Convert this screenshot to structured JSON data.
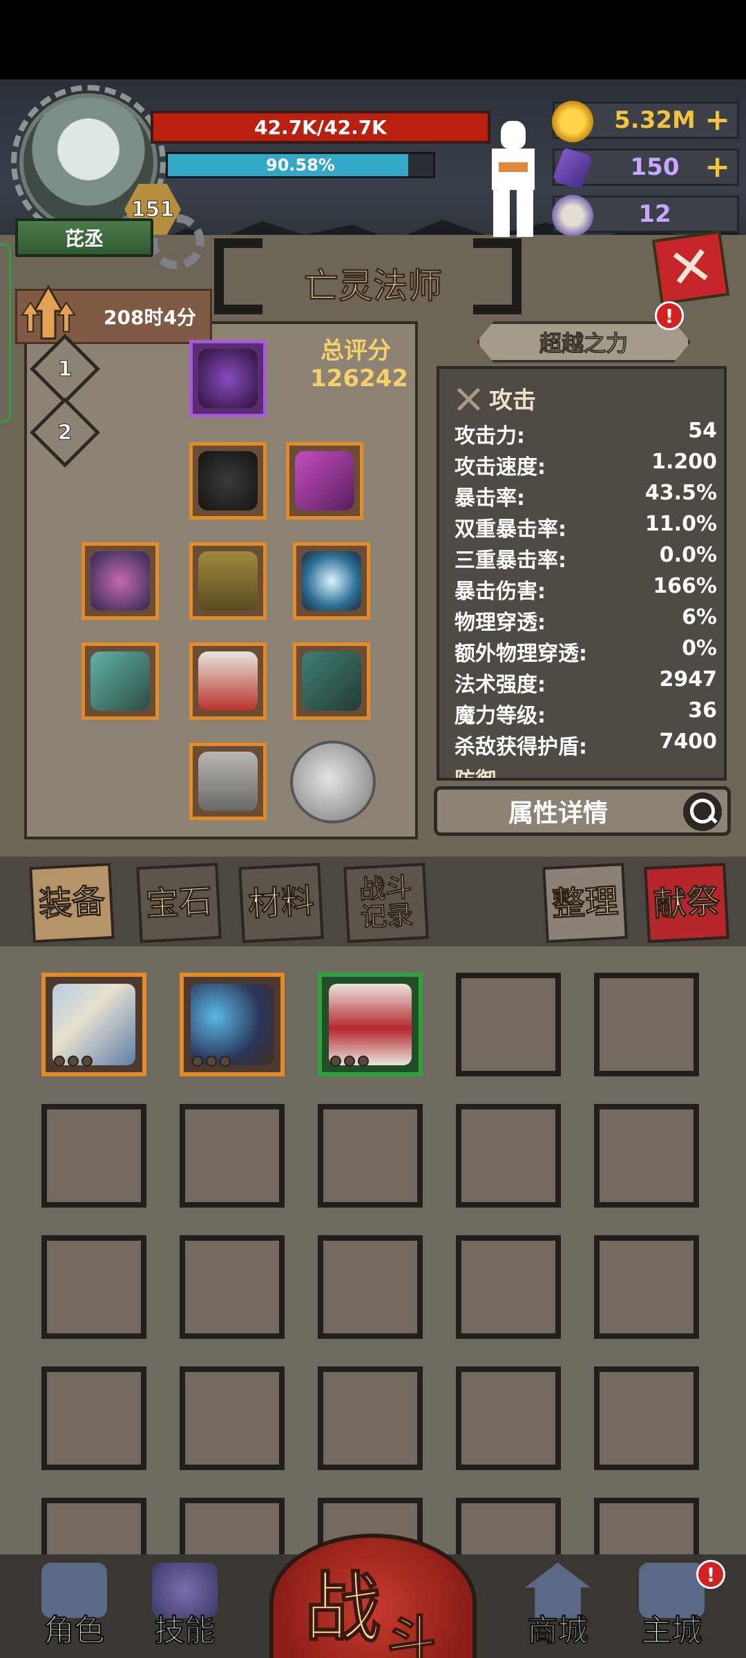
{
  "player": {
    "name": "芘丞",
    "level": "151",
    "hp_text": "42.7K/42.7K",
    "xp_text": "90.58%",
    "xp_fraction": 0.9058
  },
  "resources": [
    {
      "icon": "gold-coin-icon",
      "value": "5.32M",
      "has_plus": true,
      "color": "#f4c33c"
    },
    {
      "icon": "purple-crystal-icon",
      "value": "150",
      "has_plus": true,
      "color": "#c9a7ff"
    },
    {
      "icon": "ram-skull-icon",
      "value": "12",
      "has_plus": false,
      "color": "#c9a7ff"
    }
  ],
  "class_title": "亡灵法师",
  "timer": "208时4分",
  "loadouts": [
    "1",
    "2"
  ],
  "score": {
    "label": "总评分",
    "value": "126242"
  },
  "transcend_label": "超越之力",
  "alert_mark": "!",
  "stats": {
    "section_title": "攻击",
    "rows": [
      {
        "label": "攻击力:",
        "value": "54"
      },
      {
        "label": "攻击速度:",
        "value": "1.200"
      },
      {
        "label": "暴击率:",
        "value": "43.5%"
      },
      {
        "label": "双重暴击率:",
        "value": "11.0%"
      },
      {
        "label": "三重暴击率:",
        "value": "0.0%"
      },
      {
        "label": "暴击伤害:",
        "value": "166%"
      },
      {
        "label": "物理穿透:",
        "value": "6%"
      },
      {
        "label": "额外物理穿透:",
        "value": "0%"
      },
      {
        "label": "法术强度:",
        "value": "2947"
      },
      {
        "label": "魔力等级:",
        "value": "36"
      },
      {
        "label": "杀敌获得护盾:",
        "value": "7400"
      }
    ],
    "next_section_partial": "防御"
  },
  "detail_button": "属性详情",
  "tabs": [
    "装备",
    "宝石",
    "材料",
    "战斗记录",
    "整理",
    "献祭"
  ],
  "bottom_nav": {
    "role": "角色",
    "skill": "技能",
    "battle_1": "战",
    "battle_2": "斗",
    "shop": "商城",
    "main_city": "主城"
  },
  "colors": {
    "hp_bar": "#b9200f",
    "xp_bar": "#32a8c7",
    "score_gold": "#f5d16a",
    "rare_orange": "#e58a25",
    "epic_purple": "#a65ad6",
    "uncommon_green": "#2ea33c"
  }
}
